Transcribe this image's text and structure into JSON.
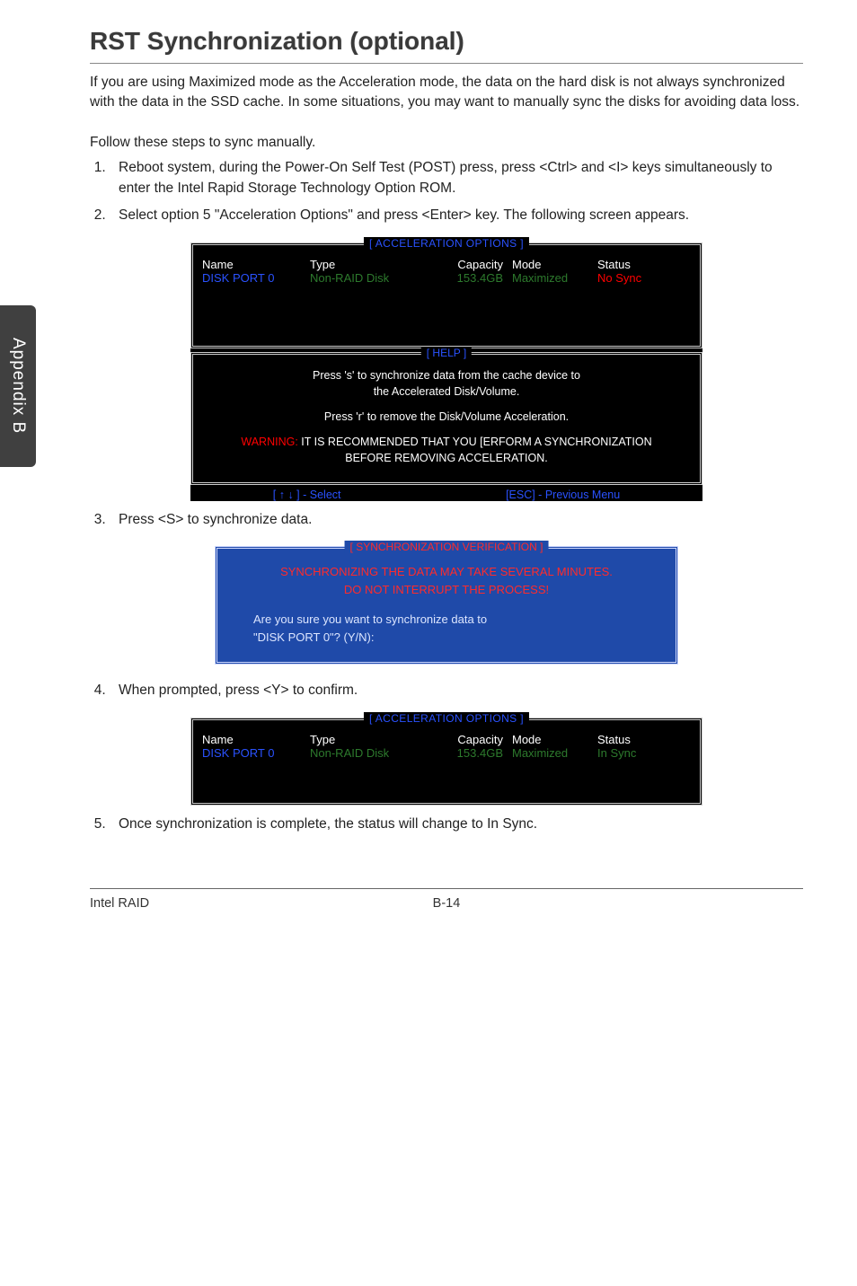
{
  "sideTab": "Appendix B",
  "sectionTitle": "RST Synchronization (optional)",
  "intro": "If you are using Maximized mode as the Acceleration mode, the data on the hard disk is not always synchronized with the data in the SSD cache. In some situations, you may want to manually sync the disks for avoiding data loss.",
  "stepsLead": "Follow these steps to sync manually.",
  "steps": {
    "s1": "Reboot system, during the Power-On Self Test (POST) press, press <Ctrl> and <I> keys simultaneously to enter the Intel Rapid Storage Technology Option ROM.",
    "s2": "Select option 5 \"Acceleration Options\" and press <Enter> key. The following screen appears.",
    "s3": "Press <S> to synchronize data.",
    "s4": "When prompted, press <Y> to confirm.",
    "s5": "Once synchronization is complete, the status will change to In Sync."
  },
  "bios": {
    "accelTitle": "[ ACCELERATION OPTIONS ]",
    "helpTitle": "[  HELP  ]",
    "headers": {
      "name": "Name",
      "type": "Type",
      "capacity": "Capacity",
      "mode": "Mode",
      "status": "Status"
    },
    "row1": {
      "name": "DISK PORT 0",
      "type": "Non-RAID Disk",
      "capacity": "153.4GB",
      "mode": "Maximized",
      "status": "No Sync"
    },
    "help": {
      "l1": "Press 's' to synchronize data from the cache device to",
      "l2": "the Accelerated Disk/Volume.",
      "l3": "Press 'r' to remove the Disk/Volume Acceleration.",
      "warnLabel": "WARNING:",
      "warnText": " IT IS RECOMMENDED THAT YOU [ERFORM A SYNCHRONIZATION",
      "warnText2": "BEFORE REMOVING ACCELERATION."
    },
    "footer": {
      "select": "[ ↑ ↓ ] - Select",
      "esc": "[ESC] - Previous Menu"
    }
  },
  "blueDialog": {
    "title": "[ SYNCHRONIZATION VERIFICATION ]",
    "warn1": "SYNCHRONIZING THE DATA MAY TAKE SEVERAL MINUTES.",
    "warn2": "DO NOT INTERRUPT THE PROCESS!",
    "prompt1": "Are you sure you want to synchronize data to",
    "prompt2": "\"DISK PORT 0\"? (Y/N):"
  },
  "bios2": {
    "row": {
      "name": "DISK PORT 0",
      "type": "Non-RAID Disk",
      "capacity": "153.4GB",
      "mode": "Maximized",
      "status": "In Sync"
    }
  },
  "footer": {
    "left": "Intel RAID",
    "center": "B-14"
  }
}
